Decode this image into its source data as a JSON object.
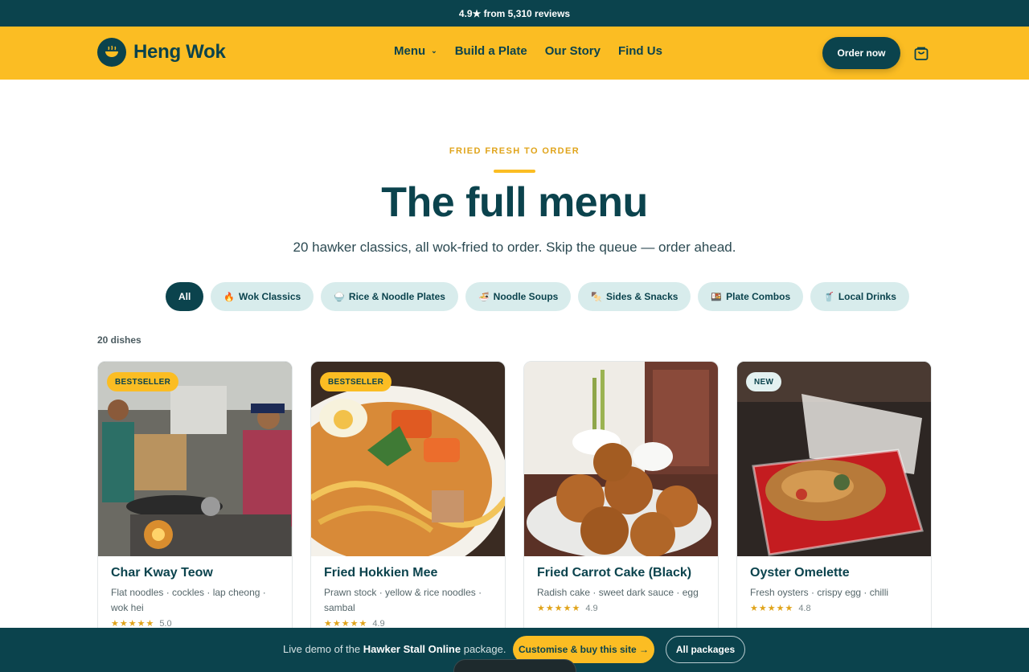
{
  "topbar": {
    "text": "4.9★ from 5,310 reviews"
  },
  "brand": {
    "name": "Heng Wok",
    "logo_icon": "wok-bowl-icon"
  },
  "nav": {
    "items": [
      {
        "label": "Menu",
        "has_dropdown": true
      },
      {
        "label": "Build a Plate"
      },
      {
        "label": "Our Story"
      },
      {
        "label": "Find Us"
      }
    ],
    "order_label": "Order now",
    "cart_icon": "shopping-bag-icon"
  },
  "hero": {
    "eyebrow": "FRIED FRESH TO ORDER",
    "title": "The full menu",
    "subtitle": "20 hawker classics, all wok-fried to order. Skip the queue — order ahead."
  },
  "filters": [
    {
      "label": "All",
      "emoji": "",
      "active": true
    },
    {
      "label": "Wok Classics",
      "emoji": "🔥"
    },
    {
      "label": "Rice & Noodle Plates",
      "emoji": "🍚"
    },
    {
      "label": "Noodle Soups",
      "emoji": "🍜"
    },
    {
      "label": "Sides & Snacks",
      "emoji": "🍢"
    },
    {
      "label": "Plate Combos",
      "emoji": "🍱"
    },
    {
      "label": "Local Drinks",
      "emoji": "🥤"
    }
  ],
  "count_label": "20 dishes",
  "dishes": [
    {
      "name": "Char Kway Teow",
      "desc": "Flat noodles · cockles · lap cheong · wok hei",
      "rating": "5.0",
      "stars": "★★★★★",
      "badge": "BESTSELLER"
    },
    {
      "name": "Fried Hokkien Mee",
      "desc": "Prawn stock · yellow & rice noodles · sambal",
      "rating": "4.9",
      "stars": "★★★★★",
      "badge": "BESTSELLER"
    },
    {
      "name": "Fried Carrot Cake (Black)",
      "desc": "Radish cake · sweet dark sauce · egg",
      "rating": "4.9",
      "stars": "★★★★★",
      "badge": ""
    },
    {
      "name": "Oyster Omelette",
      "desc": "Fresh oysters · crispy egg · chilli",
      "rating": "4.8",
      "stars": "★★★★★",
      "badge": "NEW"
    }
  ],
  "bottombar": {
    "text_pre": "Live demo of the ",
    "text_bold": "Hawker Stall Online",
    "text_post": " package.",
    "buy_label": "Customise & buy this site →",
    "packages_label": "All packages"
  },
  "colors": {
    "teal": "#0b434d",
    "yellow": "#fbbd23",
    "chip": "#d8ecec"
  }
}
